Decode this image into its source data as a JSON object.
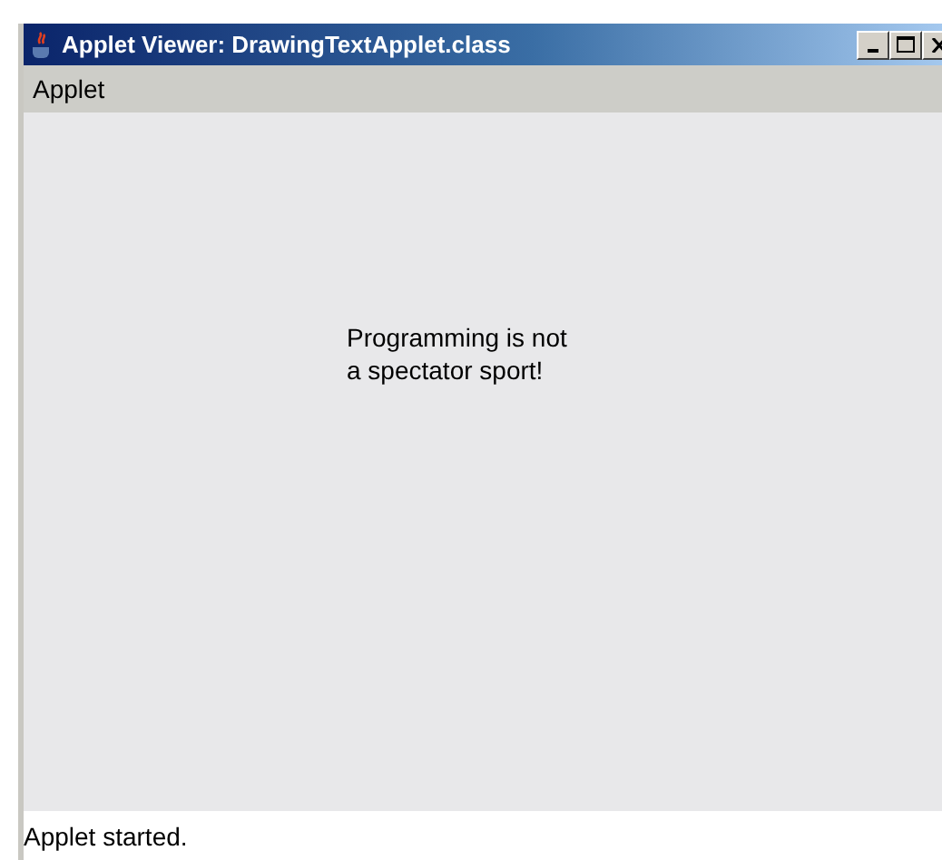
{
  "window": {
    "title": "Applet Viewer: DrawingTextApplet.class"
  },
  "menu_bar": {
    "items": [
      "Applet"
    ]
  },
  "applet": {
    "lines": [
      "Programming is not",
      "a spectator sport!"
    ]
  },
  "status_bar": "Applet started."
}
